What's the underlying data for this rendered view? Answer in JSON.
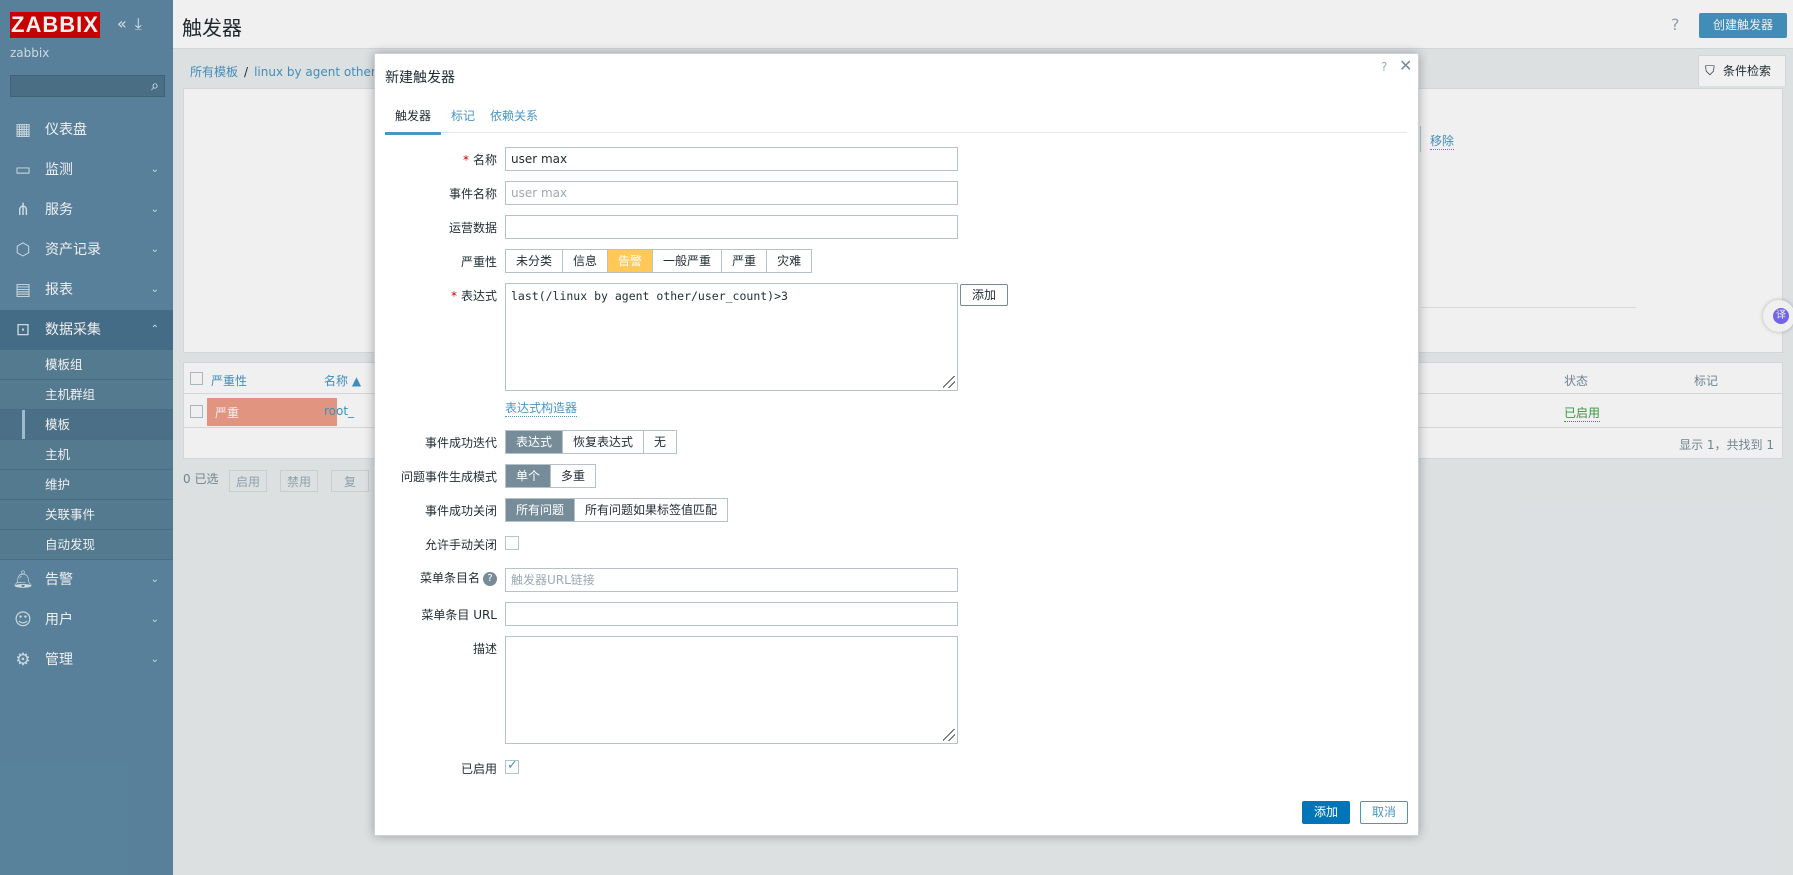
{
  "app": {
    "logo": "ZABBIX",
    "server_name": "zabbix"
  },
  "sidebar": {
    "search_placeholder": "",
    "items": [
      {
        "label": "仪表盘",
        "icon": "dashboard-icon"
      },
      {
        "label": "监测",
        "icon": "monitoring-icon"
      },
      {
        "label": "服务",
        "icon": "services-icon"
      },
      {
        "label": "资产记录",
        "icon": "inventory-icon"
      },
      {
        "label": "报表",
        "icon": "reports-icon"
      },
      {
        "label": "数据采集",
        "icon": "data-collection-icon"
      },
      {
        "label": "告警",
        "icon": "alerts-icon"
      },
      {
        "label": "用户",
        "icon": "users-icon"
      },
      {
        "label": "管理",
        "icon": "administration-icon"
      }
    ],
    "sub_items": [
      "模板组",
      "主机群组",
      "模板",
      "主机",
      "维护",
      "关联事件",
      "自动发现"
    ]
  },
  "header": {
    "title": "触发器",
    "help": "?",
    "create_button": "创建触发器"
  },
  "breadcrumb": {
    "root": "所有模板",
    "sep": "/",
    "current": "linux by agent other"
  },
  "filter": {
    "tab_label": "条件检索",
    "remove_link": "移除"
  },
  "table": {
    "col_severity": "严重性",
    "col_name": "名称 ▲",
    "col_status": "状态",
    "col_tags": "标记",
    "row": {
      "severity": "严重",
      "name": "root_",
      "status": "已启用"
    },
    "shown": "显示 1，共找到 1"
  },
  "bulk": {
    "selected": "0 已选",
    "enable": "启用",
    "disable": "禁用",
    "copy": "复"
  },
  "translate_icon": "译",
  "modal": {
    "title": "新建触发器",
    "help": "?",
    "close": "✕",
    "tabs": [
      "触发器",
      "标记",
      "依赖关系"
    ],
    "fields": {
      "name_label": "名称",
      "name_value": "user max",
      "event_name_label": "事件名称",
      "event_name_placeholder": "user max",
      "opdata_label": "运营数据",
      "severity_label": "严重性",
      "severity_options": [
        "未分类",
        "信息",
        "告警",
        "一般严重",
        "严重",
        "灾难"
      ],
      "severity_selected": "告警",
      "expression_label": "表达式",
      "expression_value": "last(/linux by agent other/user_count)>3",
      "expression_add": "添加",
      "expression_builder": "表达式构造器",
      "ok_event_label": "事件成功迭代",
      "ok_event_options": [
        "表达式",
        "恢复表达式",
        "无"
      ],
      "problem_mode_label": "问题事件生成模式",
      "problem_mode_options": [
        "单个",
        "多重"
      ],
      "ok_close_label": "事件成功关闭",
      "ok_close_options": [
        "所有问题",
        "所有问题如果标签值匹配"
      ],
      "manual_close_label": "允许手动关闭",
      "menu_name_label": "菜单条目名",
      "menu_name_placeholder": "触发器URL链接",
      "menu_url_label": "菜单条目 URL",
      "description_label": "描述",
      "enabled_label": "已启用"
    },
    "buttons": {
      "add": "添加",
      "cancel": "取消"
    }
  },
  "colors": {
    "sidebar": "#5e89a5",
    "accent": "#4796c4",
    "warning": "#ffc859",
    "high": "#e97659"
  }
}
